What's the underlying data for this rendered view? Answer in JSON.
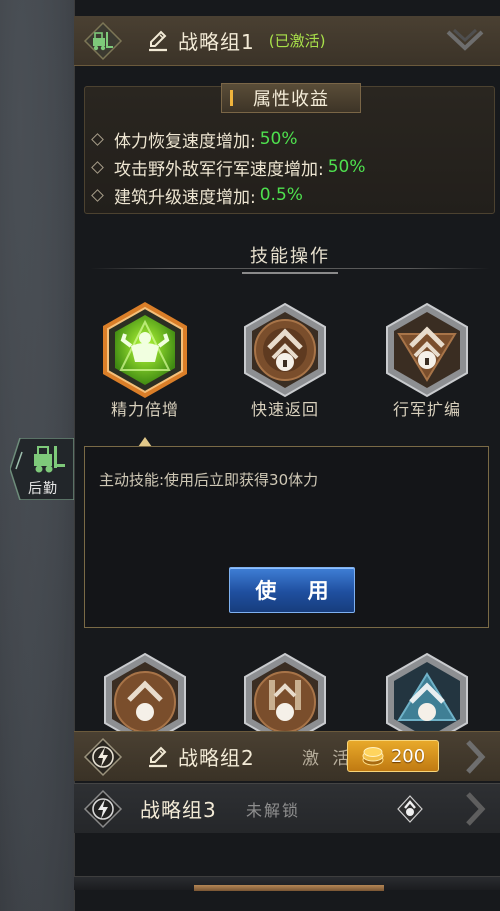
{
  "groups": [
    {
      "title": "战略组1",
      "status": "(已激活)"
    },
    {
      "title": "战略组2",
      "activate_label": "激 活",
      "cost": "200"
    },
    {
      "title": "战略组3",
      "status": "未解锁"
    }
  ],
  "attributes": {
    "heading": "属性收益",
    "items": [
      {
        "name": "体力恢复速度增加:",
        "value": "50%"
      },
      {
        "name": "攻击野外敌军行军速度增加:",
        "value": "50%"
      },
      {
        "name": "建筑升级速度增加:",
        "value": "0.5%"
      }
    ]
  },
  "skills": {
    "heading": "技能操作",
    "row1": [
      {
        "label": "精力倍增",
        "icon": "muscle-icon",
        "state": "selected"
      },
      {
        "label": "快速返回",
        "icon": "lock-icon",
        "state": "locked"
      },
      {
        "label": "行军扩编",
        "icon": "lock-icon",
        "state": "locked"
      }
    ],
    "row2_icons": [
      "lock-icon",
      "lock-icon",
      "lock-icon"
    ]
  },
  "detail": {
    "description": "主动技能:使用后立即获得30体力",
    "use_button": "使 用"
  },
  "side_tab": {
    "label": "后勤",
    "icon": "forklift-icon"
  },
  "colors": {
    "accent_gold": "#f0b43c",
    "value_green": "#4ee04e",
    "use_blue": "#2a64c0",
    "status_green": "#a8e04a"
  }
}
